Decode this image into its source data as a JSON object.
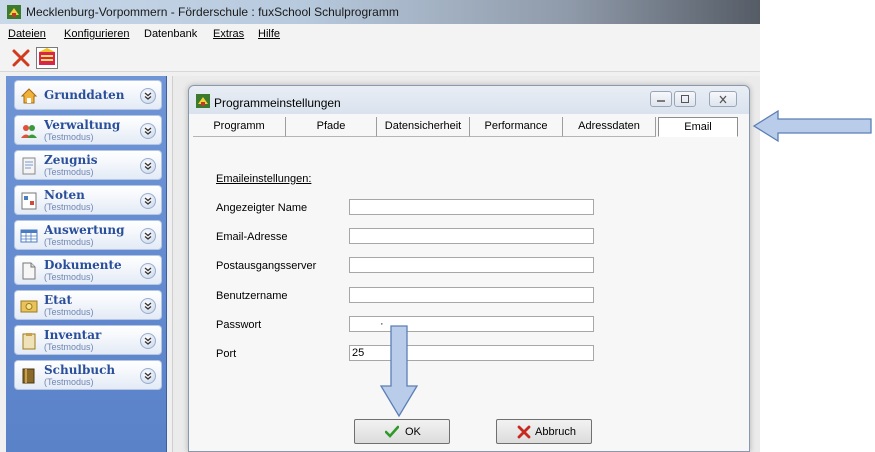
{
  "window": {
    "title": "Mecklenburg-Vorpommern - Förderschule : fuxSchool Schulprogramm"
  },
  "menubar": {
    "items": [
      {
        "label": "Dateien"
      },
      {
        "label": "Konfigurieren"
      },
      {
        "label": "Datenbank"
      },
      {
        "label": "Extras"
      },
      {
        "label": "Hilfe"
      }
    ]
  },
  "toolbar": {
    "buttons": [
      {
        "icon": "close-x-icon"
      },
      {
        "icon": "school-app-icon"
      }
    ]
  },
  "sidebar": {
    "items": [
      {
        "title": "Grunddaten",
        "subtitle": "",
        "icon": "house-icon"
      },
      {
        "title": "Verwaltung",
        "subtitle": "(Testmodus)",
        "icon": "people-icon"
      },
      {
        "title": "Zeugnis",
        "subtitle": "(Testmodus)",
        "icon": "certificate-icon"
      },
      {
        "title": "Noten",
        "subtitle": "(Testmodus)",
        "icon": "grades-icon"
      },
      {
        "title": "Auswertung",
        "subtitle": "(Testmodus)",
        "icon": "table-icon"
      },
      {
        "title": "Dokumente",
        "subtitle": "(Testmodus)",
        "icon": "document-icon"
      },
      {
        "title": "Etat",
        "subtitle": "(Testmodus)",
        "icon": "budget-icon"
      },
      {
        "title": "Inventar",
        "subtitle": "(Testmodus)",
        "icon": "clipboard-icon"
      },
      {
        "title": "Schulbuch",
        "subtitle": "(Testmodus)",
        "icon": "book-icon"
      }
    ]
  },
  "dialog": {
    "title": "Programmeinstellungen",
    "tabs": [
      {
        "label": "Programm"
      },
      {
        "label": "Pfade"
      },
      {
        "label": "Datensicherheit"
      },
      {
        "label": "Performance"
      },
      {
        "label": "Adressdaten"
      },
      {
        "label": "Email",
        "active": true
      }
    ],
    "section_title": "Emaileinstellungen:",
    "fields": [
      {
        "label": "Angezeigter Name",
        "value": ""
      },
      {
        "label": "Email-Adresse",
        "value": ""
      },
      {
        "label": "Postausgangsserver",
        "value": ""
      },
      {
        "label": "Benutzername",
        "value": ""
      },
      {
        "label": "Passwort",
        "value": "·"
      },
      {
        "label": "Port",
        "value": "25"
      }
    ],
    "ok_label": "OK",
    "cancel_label": "Abbruch"
  },
  "colors": {
    "sidebar_bg": "#5a82c9",
    "sidebar_title": "#2a4f9a",
    "annotation_arrow": "#b9cdea"
  }
}
